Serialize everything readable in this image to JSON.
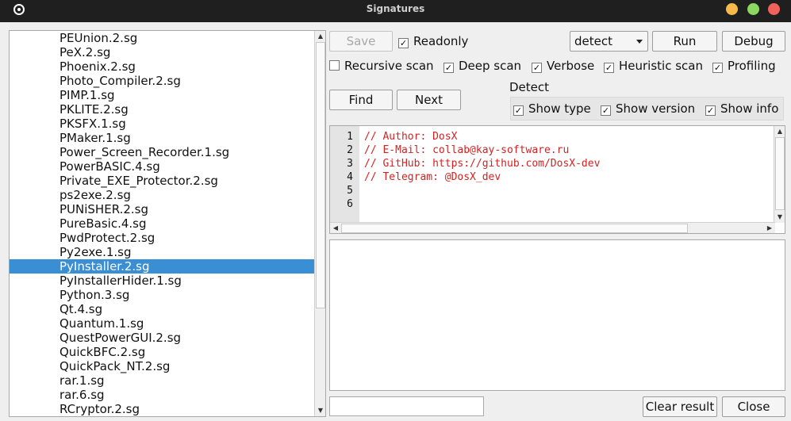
{
  "window": {
    "title": "Signatures"
  },
  "list": {
    "items": [
      "PEUnion.2.sg",
      "PeX.2.sg",
      "Phoenix.2.sg",
      "Photo_Compiler.2.sg",
      "PIMP.1.sg",
      "PKLITE.2.sg",
      "PKSFX.1.sg",
      "PMaker.1.sg",
      "Power_Screen_Recorder.1.sg",
      "PowerBASIC.4.sg",
      "Private_EXE_Protector.2.sg",
      "ps2exe.2.sg",
      "PUNiSHER.2.sg",
      "PureBasic.4.sg",
      "PwdProtect.2.sg",
      "Py2exe.1.sg",
      "PyInstaller.2.sg",
      "PyInstallerHider.1.sg",
      "Python.3.sg",
      "Qt.4.sg",
      "Quantum.1.sg",
      "QuestPowerGUI.2.sg",
      "QuickBFC.2.sg",
      "QuickPack_NT.2.sg",
      "rar.1.sg",
      "rar.6.sg",
      "RCryptor.2.sg"
    ],
    "selected_index": 16
  },
  "toolbar": {
    "save_label": "Save",
    "readonly_label": "Readonly",
    "readonly_checked": true,
    "mode_selected": "detect",
    "run_label": "Run",
    "debug_label": "Debug"
  },
  "options": {
    "recursive_scan": {
      "label": "Recursive scan",
      "checked": false
    },
    "deep_scan": {
      "label": "Deep scan",
      "checked": true
    },
    "verbose": {
      "label": "Verbose",
      "checked": true
    },
    "heuristic_scan": {
      "label": "Heuristic scan",
      "checked": true
    },
    "profiling": {
      "label": "Profiling",
      "checked": true
    }
  },
  "search": {
    "find_label": "Find",
    "next_label": "Next"
  },
  "detect": {
    "group_label": "Detect",
    "show_type": {
      "label": "Show type",
      "checked": true
    },
    "show_version": {
      "label": "Show version",
      "checked": true
    },
    "show_info": {
      "label": "Show info",
      "checked": true
    }
  },
  "editor": {
    "line_numbers": [
      "1",
      "2",
      "3",
      "4",
      "5",
      "6"
    ],
    "lines": [
      "// Author: DosX",
      "// E-Mail: collab@kay-software.ru",
      "// GitHub: https://github.com/DosX-dev",
      "// Telegram: @DosX_dev",
      "",
      ""
    ]
  },
  "bottom": {
    "filter_value": "",
    "clear_result_label": "Clear result",
    "close_label": "Close"
  },
  "colors": {
    "selection": "#3a8ed4",
    "comment": "#d42222"
  }
}
